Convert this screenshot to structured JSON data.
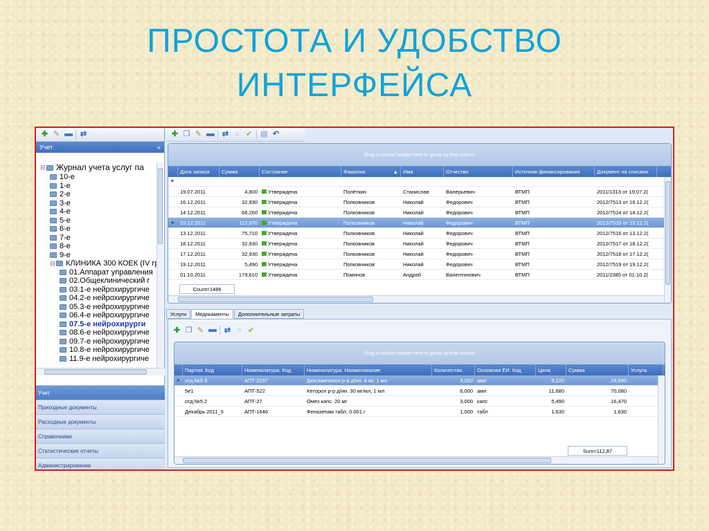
{
  "slide": {
    "title_line1": "ПРОСТОТА И УДОБСТВО",
    "title_line2": "ИНТЕРФЕЙСА"
  },
  "left_panel": {
    "header": "Учет",
    "collapse": "«",
    "tree": [
      {
        "label": "Журнал учета услуг па",
        "level": 0,
        "expander": "⊟",
        "root": true
      },
      {
        "label": "10-е",
        "level": 1
      },
      {
        "label": "1-е",
        "level": 1
      },
      {
        "label": "2-е",
        "level": 1
      },
      {
        "label": "3-е",
        "level": 1
      },
      {
        "label": "4-е",
        "level": 1
      },
      {
        "label": "5-е",
        "level": 1
      },
      {
        "label": "6-е",
        "level": 1
      },
      {
        "label": "7-е",
        "level": 1
      },
      {
        "label": "8-е",
        "level": 1
      },
      {
        "label": "9-е",
        "level": 1
      },
      {
        "label": "КЛИНИКА 300 КОЕК (IV гр",
        "level": 1,
        "expander": "⊟"
      },
      {
        "label": "01.Аппарат управления",
        "level": 2
      },
      {
        "label": "02.Общеклинический г",
        "level": 2
      },
      {
        "label": "03.1-е нейрохирургиче",
        "level": 2
      },
      {
        "label": "04.2-е нейрохирургиче",
        "level": 2
      },
      {
        "label": "05.3-е нейрохирургиче",
        "level": 2
      },
      {
        "label": "06.4-е нейрохирургиче",
        "level": 2
      },
      {
        "label": "07.5-е нейрохирурги",
        "level": 2,
        "selected": true
      },
      {
        "label": "08.6-е нейрохирургиче",
        "level": 2
      },
      {
        "label": "09.7-е нейрохирургиче",
        "level": 2
      },
      {
        "label": "10.8-е нейрохирургиче",
        "level": 2
      },
      {
        "label": "11.9-е нейрохирургиче",
        "level": 2
      }
    ],
    "nav": [
      {
        "label": "Учет",
        "active": true
      },
      {
        "label": "Приходные документы"
      },
      {
        "label": "Расходные документы"
      },
      {
        "label": "Справочники"
      },
      {
        "label": "Статистические отчеты"
      },
      {
        "label": "Администрирование"
      }
    ]
  },
  "main_grid": {
    "group_hint": "Drag a column header here to group by that column",
    "columns": [
      "Дата записи",
      "Сумма",
      "Состояние",
      "Фамилия",
      "Имя",
      "Отчество",
      "Источник финансирования",
      "Документ на списани"
    ],
    "sort_indicator": "▲",
    "rows": [
      [
        "19.07.2011",
        "4,800",
        "Утверждена",
        "Полёткин",
        "Станислав",
        "Валерьевич",
        "ВТМП",
        "2011/1313 от 19.07.2("
      ],
      [
        "16.12.2011",
        "32,930",
        "Утверждена",
        "Полковников",
        "Николай",
        "Федорович",
        "ВТМП",
        "2012/7513 от 16.12.2("
      ],
      [
        "14.12.2011",
        "66,260",
        "Утверждена",
        "Полковников",
        "Николай",
        "Федорович",
        "ВТМП",
        "2012/7514 от 14.12.2("
      ],
      [
        "15.12.2011",
        "112,870",
        "Утверждена",
        "Полковников",
        "Николай",
        "Федорович",
        "ВТМП",
        "2012/7515 от 15.12.2("
      ],
      [
        "13.12.2011",
        "75,710",
        "Утверждена",
        "Полковников",
        "Николай",
        "Федорович",
        "ВТМП",
        "2012/7516 от 13.12.2("
      ],
      [
        "18.12.2011",
        "32,930",
        "Утверждена",
        "Полковников",
        "Николай",
        "Федорович",
        "ВТМП",
        "2012/7517 от 18.12.2("
      ],
      [
        "17.12.2011",
        "32,930",
        "Утверждена",
        "Полковников",
        "Николай",
        "Федорович",
        "ВТМП",
        "2012/7518 от 17.12.2("
      ],
      [
        "19.12.2011",
        "5,490",
        "Утверждена",
        "Полковников",
        "Николай",
        "Федорович",
        "ВТМП",
        "2012/7519 от 19.12.2("
      ],
      [
        "01.10.2011",
        "179,610",
        "Утверждена",
        "Поминов",
        "Андрей",
        "Валентинович",
        "ВТМП",
        "2011/2385 от 01.10.2("
      ]
    ],
    "selected_row": 3,
    "count": "Count=1486"
  },
  "tabs": [
    "Услуги",
    "Медикаменты",
    "Дополнительные затраты"
  ],
  "active_tab": 1,
  "sub_grid": {
    "group_hint": "Drag a column header here to group by that column",
    "columns": [
      "Партия. Код",
      "Номенклатура. Код",
      "Номенклатура. Наименование",
      "Количество.",
      "Основная ЕИ. Код",
      "Цена",
      "Сумма",
      "Услуга."
    ],
    "rows": [
      [
        "отд.№5.3",
        "АПТ-2287",
        "Дексаметазон р-р д/ин. 4 мг, 1 мл",
        "3,000",
        "амп",
        "8,220",
        "24,690",
        ""
      ],
      [
        "5е1",
        "АПТ-522",
        "Кеторол р-р д/ин. 30 мг/мл, 1 мл",
        "6,000",
        "амп",
        "11,680",
        "70,080",
        ""
      ],
      [
        "отд.№5.2",
        "АПТ-27",
        "Омез капс. 20 мг",
        "3,000",
        "капс",
        "5,490",
        "16,470",
        ""
      ],
      [
        "Декабрь 2011_5",
        "АПТ-1646",
        "Феназепам табл. 0.001 г",
        "1,000",
        "табл",
        "1,630",
        "1,630",
        ""
      ]
    ],
    "selected_row": 0,
    "sum": "Sum=112,87"
  },
  "colors": {
    "title": "#0fa3dc",
    "frame_border": "#d21f1f",
    "header_blue": "#3d6dbc",
    "selection": "#6f97d6",
    "status_flag": "#4aa12e"
  }
}
